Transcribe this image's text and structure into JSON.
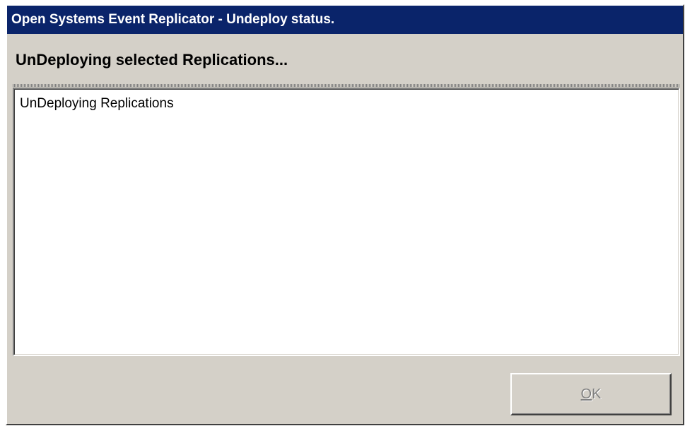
{
  "window": {
    "title": "Open Systems Event Replicator - Undeploy status."
  },
  "main": {
    "heading": "UnDeploying selected Replications...",
    "log_lines": [
      "UnDeploying Replications"
    ]
  },
  "buttons": {
    "ok_label": "OK",
    "ok_enabled": false
  },
  "colors": {
    "titlebar": "#0a246a",
    "window_bg": "#d4d0c8",
    "disabled_text": "#808080"
  }
}
